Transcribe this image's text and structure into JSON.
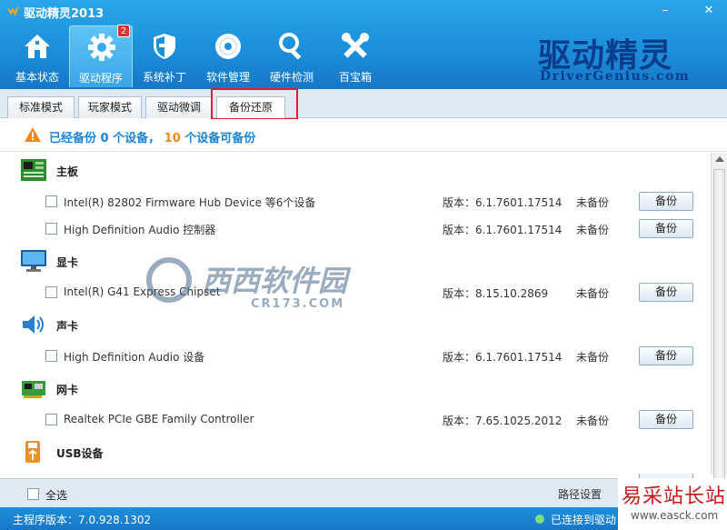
{
  "app": {
    "title": "驱动精灵2013",
    "min_glyph": "–",
    "close_glyph": "✕"
  },
  "nav": [
    {
      "label": "基本状态",
      "icon": "home-icon"
    },
    {
      "label": "驱动程序",
      "icon": "gear-icon",
      "badge": "2"
    },
    {
      "label": "系统补丁",
      "icon": "shield-icon"
    },
    {
      "label": "软件管理",
      "icon": "disc-icon"
    },
    {
      "label": "硬件检测",
      "icon": "magnifier-icon"
    },
    {
      "label": "百宝箱",
      "icon": "tools-icon"
    }
  ],
  "brand": {
    "name": "驱动精灵",
    "url": "DriverGenius.com"
  },
  "tabs": [
    {
      "label": "标准模式"
    },
    {
      "label": "玩家模式"
    },
    {
      "label": "驱动微调"
    },
    {
      "label": "备份还原",
      "active": true
    }
  ],
  "summary": {
    "prefix": "已经备份",
    "backed_count": "0",
    "mid": "个设备，",
    "available_count": "10",
    "suffix": "个设备可备份"
  },
  "categories": [
    {
      "label": "主板",
      "icon": "motherboard-icon"
    },
    {
      "label": "显卡",
      "icon": "monitor-icon"
    },
    {
      "label": "声卡",
      "icon": "speaker-icon"
    },
    {
      "label": "网卡",
      "icon": "network-card-icon"
    },
    {
      "label": "USB设备",
      "icon": "usb-icon"
    }
  ],
  "devices": [
    {
      "name": "Intel(R) 82802 Firmware Hub Device 等6个设备",
      "version": "版本：6.1.7601.17514",
      "status": "未备份",
      "button": "备份"
    },
    {
      "name": "High Definition Audio 控制器",
      "version": "版本：6.1.7601.17514",
      "status": "未备份",
      "button": "备份"
    },
    {
      "name": "Intel(R) G41 Express Chipset",
      "version": "版本：8.15.10.2869",
      "status": "未备份",
      "button": "备份"
    },
    {
      "name": "High Definition Audio 设备",
      "version": "版本：6.1.7601.17514",
      "status": "未备份",
      "button": "备份"
    },
    {
      "name": "Realtek PCIe GBE Family Controller",
      "version": "版本：7.65.1025.2012",
      "status": "未备份",
      "button": "备份"
    }
  ],
  "bottom": {
    "select_all": "全选",
    "path_settings": "路径设置"
  },
  "status": {
    "version": "主程序版本：7.0.928.1302",
    "connection": "已连接到驱动"
  },
  "watermark": {
    "cn": "西西软件园",
    "en": "CR173.COM"
  },
  "corner": {
    "cn": "易采站长站",
    "en": "www.easck.com"
  },
  "colors": {
    "header": "#1d8fdb",
    "accent_blue": "#1a84d8",
    "accent_orange": "#f08a1c",
    "highlight": "#e02020"
  }
}
